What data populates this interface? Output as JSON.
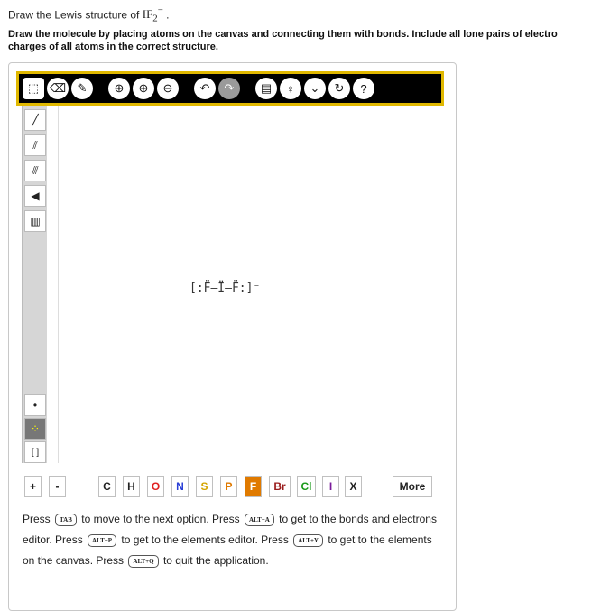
{
  "question": {
    "line1_prefix": "Draw the Lewis structure of ",
    "formula": "IF",
    "formula_sub": "2",
    "formula_sup": "−",
    "line1_suffix": " .",
    "instructions_l1": "Draw the molecule by placing atoms on the canvas and connecting them with bonds. Include all lone pairs of electro",
    "instructions_l2": "charges of all atoms in the correct structure."
  },
  "toolbar": {
    "buttons": [
      {
        "name": "select-icon",
        "glyph": "⬚"
      },
      {
        "name": "eraser-icon",
        "glyph": "⌫"
      },
      {
        "name": "pencil-icon",
        "glyph": "✎"
      },
      {
        "name": "zoom-fit-icon",
        "glyph": "⊕"
      },
      {
        "name": "zoom-in-icon",
        "glyph": "⊕"
      },
      {
        "name": "zoom-out-icon",
        "glyph": "⊖"
      },
      {
        "name": "undo-icon",
        "glyph": "↶"
      },
      {
        "name": "redo-icon",
        "glyph": "↷"
      },
      {
        "name": "template-icon",
        "glyph": "▤"
      },
      {
        "name": "hint-icon",
        "glyph": "♀"
      },
      {
        "name": "chevron-down-icon",
        "glyph": "⌄"
      },
      {
        "name": "reset-icon",
        "glyph": "↻"
      },
      {
        "name": "help-icon",
        "glyph": "?"
      }
    ]
  },
  "left_tools": [
    {
      "name": "single-bond-icon",
      "glyph": "╱"
    },
    {
      "name": "double-bond-icon",
      "glyph": "⫽"
    },
    {
      "name": "triple-bond-icon",
      "glyph": "⫻"
    },
    {
      "name": "wedge-bond-icon",
      "glyph": "◀"
    },
    {
      "name": "hash-bond-icon",
      "glyph": "▥"
    }
  ],
  "bottom_tools": [
    {
      "name": "radical-icon",
      "glyph": "•"
    },
    {
      "name": "lone-pair-icon",
      "glyph": "⁘"
    },
    {
      "name": "bracket-icon",
      "glyph": "[ ]"
    }
  ],
  "molecule_text": "[:F̈—Ï—F̈:]⁻",
  "elements": {
    "plus": "+",
    "minus": "-",
    "list": [
      {
        "symbol": "C",
        "color": "#222222"
      },
      {
        "symbol": "H",
        "color": "#222222"
      },
      {
        "symbol": "O",
        "color": "#e02020"
      },
      {
        "symbol": "N",
        "color": "#2a3fd6"
      },
      {
        "symbol": "S",
        "color": "#d4a400"
      },
      {
        "symbol": "P",
        "color": "#e07a00"
      },
      {
        "symbol": "F",
        "color": "#222222"
      },
      {
        "symbol": "Br",
        "color": "#9a1c1c"
      },
      {
        "symbol": "Cl",
        "color": "#1a9a1a"
      },
      {
        "symbol": "I",
        "color": "#7a1a9a"
      },
      {
        "symbol": "X",
        "color": "#222222"
      }
    ],
    "selected_bg": "#e07a00",
    "more": "More"
  },
  "help": {
    "t1": "Press",
    "k1": "TAB",
    "t2": "to move to the next option. Press",
    "k2": "ALT+A",
    "t3": "to get to the bonds and electrons editor. Press",
    "k3": "ALT+P",
    "t4": "to get to the elements editor. Press",
    "k4": "ALT+Y",
    "t5": "to get to the elements on the canvas. Press",
    "k5": "ALT+Q",
    "t6": "to quit the application."
  }
}
